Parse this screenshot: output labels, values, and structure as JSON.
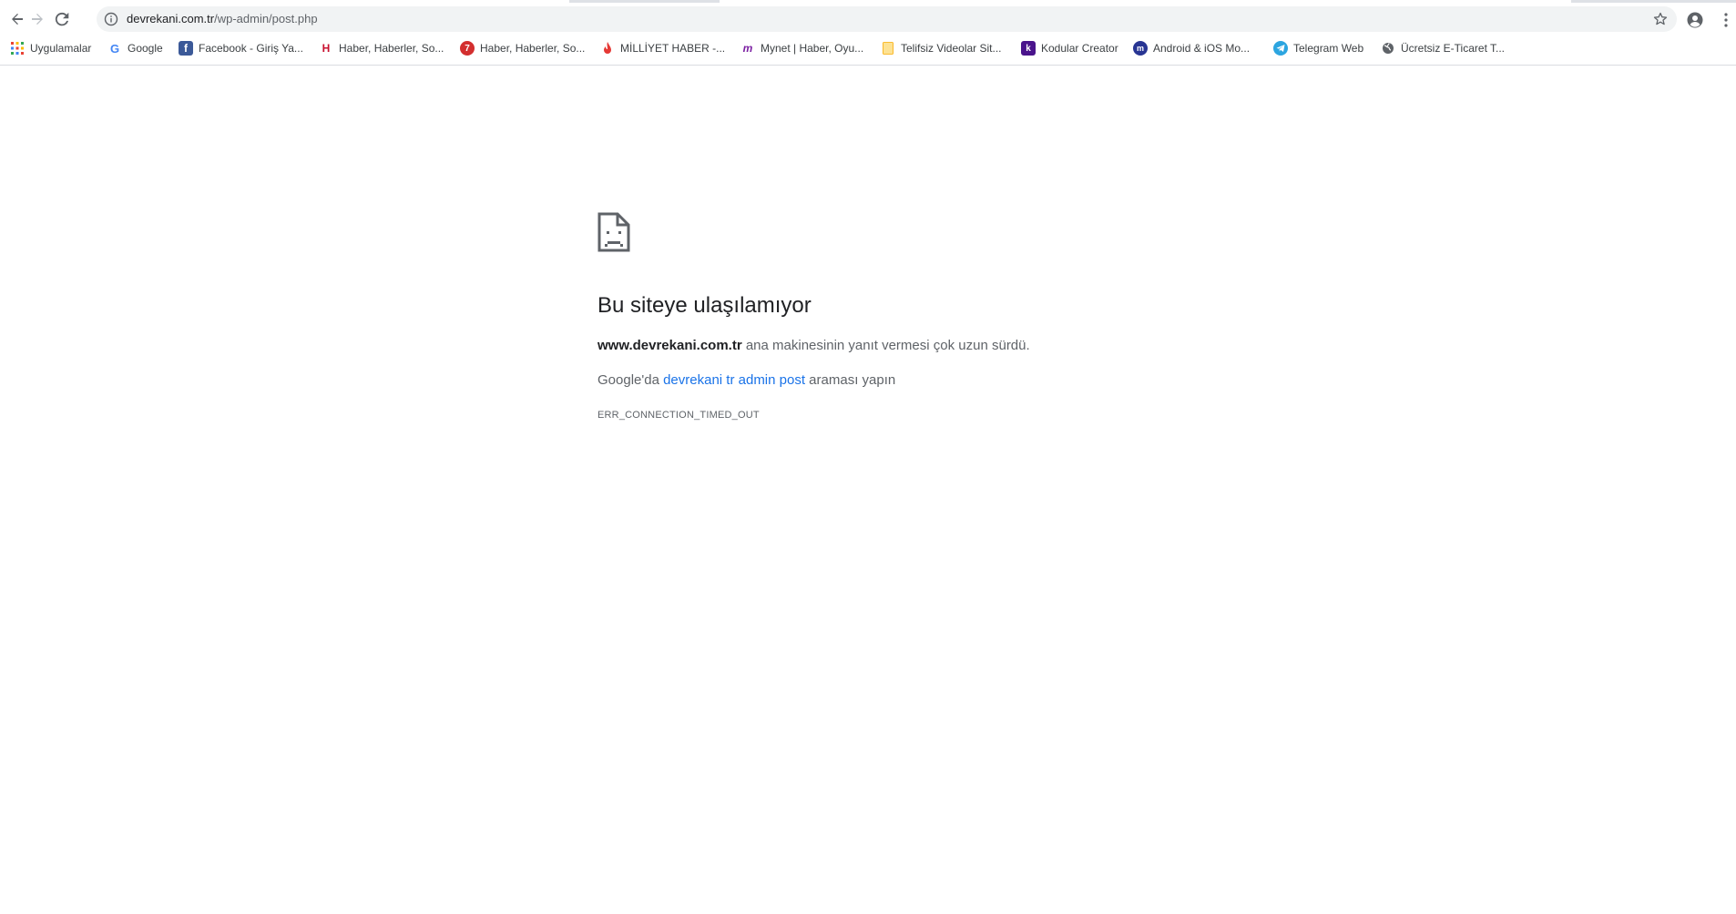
{
  "omnibox": {
    "url_host": "devrekani.com.tr",
    "url_path": "/wp-admin/post.php"
  },
  "bookmarks": [
    {
      "label": "Uygulamalar",
      "icon": "apps-grid-icon",
      "color": "#ea4335"
    },
    {
      "label": "Google",
      "icon": "google-icon",
      "color": "#4285f4"
    },
    {
      "label": "Facebook - Giriş Ya...",
      "icon": "facebook-icon",
      "color": "#3b5998"
    },
    {
      "label": "Haber, Haberler, So...",
      "icon": "haberturk-icon",
      "color": "#c8102e"
    },
    {
      "label": "Haber, Haberler, So...",
      "icon": "haber7-icon",
      "color": "#d32f2f"
    },
    {
      "label": "MİLLİYET HABER -...",
      "icon": "milliyet-icon",
      "color": "#e53935"
    },
    {
      "label": "Mynet | Haber, Oyu...",
      "icon": "mynet-icon",
      "color": "#7b1fa2"
    },
    {
      "label": "Telifsiz Videolar Sit...",
      "icon": "folder-icon",
      "color": "#fdd663"
    },
    {
      "label": "Kodular Creator",
      "icon": "kodular-icon",
      "color": "#4a148c"
    },
    {
      "label": "Android & iOS Mo...",
      "icon": "android-ios-icon",
      "color": "#1a237e"
    },
    {
      "label": "Telegram Web",
      "icon": "telegram-icon",
      "color": "#2ca5e0"
    },
    {
      "label": "Ücretsiz E-Ticaret T...",
      "icon": "globe-icon",
      "color": "#5f6368"
    }
  ],
  "error": {
    "title": "Bu siteye ulaşılamıyor",
    "host": "www.devrekani.com.tr",
    "desc_rest": " ana makinesinin yanıt vermesi çok uzun sürdü.",
    "suggest_prefix": "Google'da ",
    "suggest_link": "devrekani tr admin post",
    "suggest_suffix": " araması yapın",
    "code": "ERR_CONNECTION_TIMED_OUT"
  }
}
